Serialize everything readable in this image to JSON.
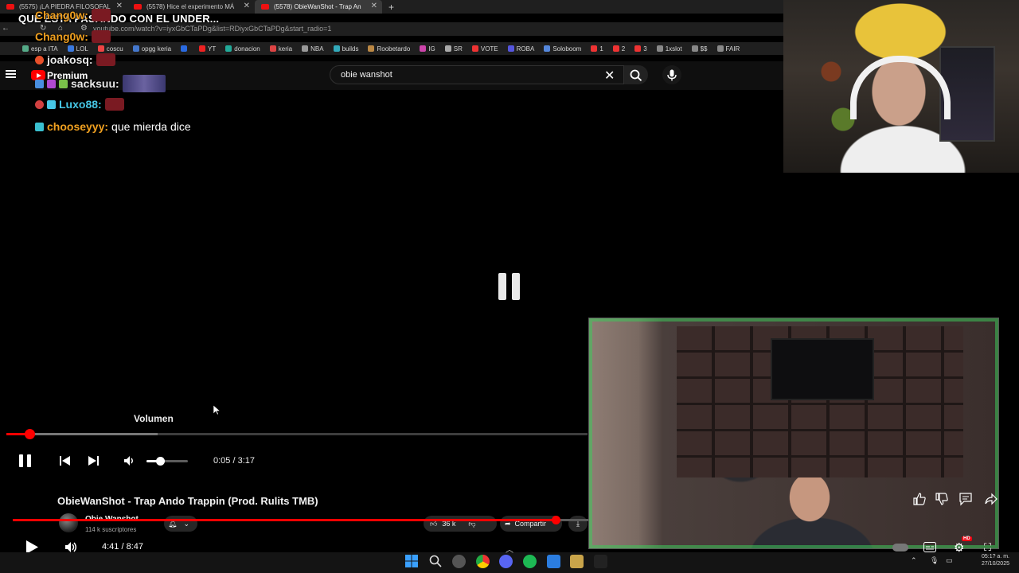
{
  "browser": {
    "tabs": [
      {
        "label": "(5575) ¡LA PIEDRA FILOSOFAL"
      },
      {
        "label": "(5578) Hice el experimento MÁ"
      },
      {
        "label": "(5578) ObieWanShot - Trap An"
      }
    ],
    "new_tab": "+",
    "url": "youtube.com/watch?v=iyxGbCTaPDg&list=RDiyxGbCTaPDg&start_radio=1",
    "bookmarks": [
      "esp a ITA",
      "LOL",
      "coscu",
      "opgg keria",
      "",
      "YT",
      "donacion",
      "keria",
      "NBA",
      "builds",
      "Roobetardo",
      "IG",
      "SR",
      "VOTE",
      "ROBA",
      "Soloboom",
      "1",
      "2",
      "3",
      "1xslot",
      "$$",
      "FAIR"
    ]
  },
  "youtube": {
    "premium_label": "Premium",
    "search_value": "obie wanshot",
    "clear_glyph": "✕"
  },
  "stream_overlay": {
    "title": "QUE ESTA PASANDO CON EL UNDER...",
    "chat": [
      {
        "user": "Chang0w:",
        "color": "#f0a020",
        "message": ""
      },
      {
        "user": "Chang0w:",
        "color": "#f0a020",
        "message": ""
      },
      {
        "user": "joakosq:",
        "color": "#e9e9e9",
        "message": ""
      },
      {
        "user": "sacksuu:",
        "color": "#e9e9e9",
        "message": ""
      },
      {
        "user": "Luxo88:",
        "color": "#46c7e6",
        "message": ""
      },
      {
        "user": "chooseyyy:",
        "color": "#f0a020",
        "message": "que mierda dice"
      }
    ]
  },
  "player": {
    "tooltip": "Volumen",
    "time": "0:05 / 3:17",
    "progress_fraction": 0.04,
    "loaded_fraction": 0.26,
    "volume_fraction": 0.32,
    "video_title": "ObieWanShot - Trap Ando Trappin (Prod. Rulits TMB)",
    "channel_name": "Obie Wanshot",
    "subscribers": "114 k suscriptores",
    "likes": "36 k",
    "share_label": "Compartir"
  },
  "mini_player": {
    "time": "4:41 / 8:47",
    "progress_fraction": 0.8,
    "hd_badge": "HD"
  },
  "taskbar": {
    "clock": "05:1? a. m.",
    "date": "27/10/2025"
  },
  "colors": {
    "accent_red": "#ff0000",
    "chat_orange": "#f0a020",
    "chat_cyan": "#46c7e6"
  }
}
